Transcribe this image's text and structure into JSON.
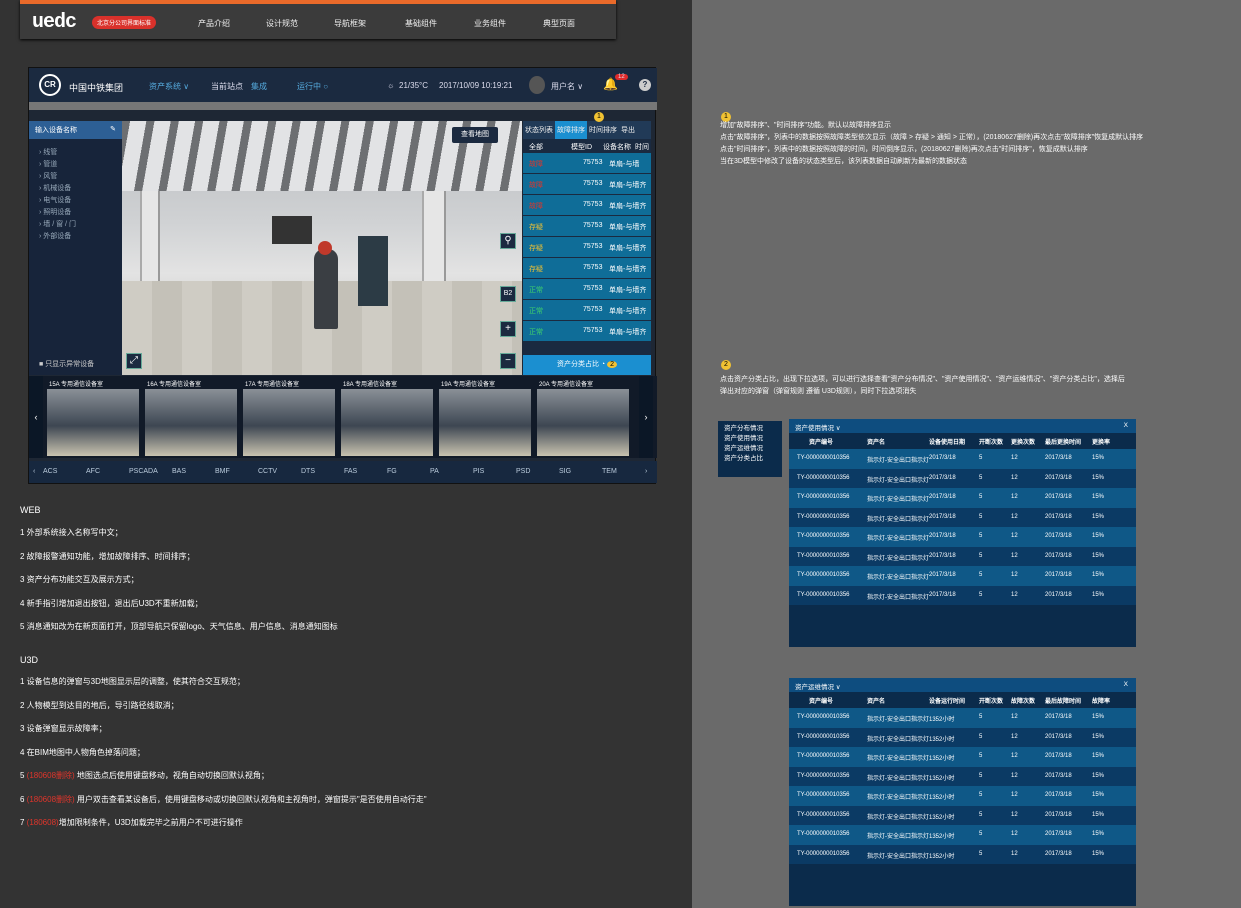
{
  "topnav": {
    "logo": "uedc",
    "badge": "北京分公司界面标准",
    "items": [
      "产品介绍",
      "设计规范",
      "导航框架",
      "基础组件",
      "业务组件",
      "典型页面"
    ]
  },
  "header": {
    "brand": "中国中铁集团",
    "system": "资产系统 ∨",
    "station_label": "当前站点",
    "station_value": "集成",
    "running": "运行中 ○",
    "weather": "21/35°C",
    "datetime": "2017/10/09  10:19:21",
    "user": "用户名 ∨",
    "notif": "12",
    "help": "?"
  },
  "sidebar": {
    "title": "输入设备名称",
    "items": [
      "线管",
      "管道",
      "风管",
      "机械设备",
      "电气设备",
      "照明设备",
      "墙 / 窗 / 门",
      "外部设备"
    ],
    "footer": "只显示异常设备"
  },
  "scene": {
    "map_button": "查看地图",
    "floor": "B2"
  },
  "status_panel": {
    "tabs": [
      "状态列表",
      "故障排序",
      "时间排序",
      "导出"
    ],
    "cols": [
      "全部",
      "模型ID",
      "设备名称",
      "时间"
    ],
    "rows": [
      {
        "state": "故障",
        "id": "75753",
        "name": "单扇-与墙"
      },
      {
        "state": "故障",
        "id": "75753",
        "name": "单扇-与墙齐"
      },
      {
        "state": "故障",
        "id": "75753",
        "name": "单扇-与墙齐"
      },
      {
        "state": "存疑",
        "id": "75753",
        "name": "单扇-与墙齐"
      },
      {
        "state": "存疑",
        "id": "75753",
        "name": "单扇-与墙齐"
      },
      {
        "state": "存疑",
        "id": "75753",
        "name": "单扇-与墙齐"
      },
      {
        "state": "正常",
        "id": "75753",
        "name": "单扇-与墙齐"
      },
      {
        "state": "正常",
        "id": "75753",
        "name": "单扇-与墙齐"
      },
      {
        "state": "正常",
        "id": "75753",
        "name": "单扇-与墙齐"
      }
    ],
    "footer": "资产分类占比",
    "marker1": "1",
    "marker2": "2"
  },
  "thumbs": [
    "15A 专用通信设备室",
    "16A 专用通信设备室",
    "17A 专用通信设备室",
    "18A 专用通信设备室",
    "19A 专用通信设备室",
    "20A 专用通信设备室"
  ],
  "sysbar": [
    "ACS",
    "AFC",
    "PSCADA",
    "BAS",
    "BMF",
    "CCTV",
    "DTS",
    "FAS",
    "FG",
    "PA",
    "PIS",
    "PSD",
    "SIG",
    "TEM"
  ],
  "web_title": "WEB",
  "web_notes": [
    "1 外部系统接入名称写中文；",
    "2 故障报警通知功能，增加故障排序、时间排序；",
    "3 资产分布功能交互及展示方式；",
    "4 新手指引增加退出按钮，退出后U3D不重新加载；",
    "5 消息通知改为在新页面打开，顶部导航只保留logo、天气信息、用户信息、消息通知图标"
  ],
  "u3d_title": "U3D",
  "u3d_notes": [
    {
      "pre": "1 设备信息的弹窗与3D地图显示层的调整，使其符合交互规范；",
      "red": "",
      "post": ""
    },
    {
      "pre": "2 人物模型到达目的地后，导引路径线取消；",
      "red": "",
      "post": ""
    },
    {
      "pre": "3 设备弹窗显示故障率；",
      "red": "",
      "post": ""
    },
    {
      "pre": "4 在BIM地图中人物角色掉落问题；",
      "red": "",
      "post": ""
    },
    {
      "pre": "5 ",
      "red": "(180608删除)",
      "post": " 地图选点后使用键盘移动，视角自动切换回默认视角；"
    },
    {
      "pre": "6 ",
      "red": "(180608删除)",
      "post": " 用户双击查看某设备后，使用键盘移动或切换回默认视角和主视角时，弹窗提示\"是否使用自动行走\""
    },
    {
      "pre": "7 ",
      "red": "(180608)",
      "post": "增加限制条件，U3D加载完毕之前用户不可进行操作"
    }
  ],
  "right_notes1": {
    "marker": "1",
    "lines": [
      "增加\"故障排序\"、\"时间排序\"功能。默认以故障排序显示",
      "点击\"故障排序\"，列表中的数据按照故障类型依次显示（故障 > 存疑 > 通知 > 正常），(20180627删除)再次点击\"故障排序\"恢复成默认排序",
      "点击\"时间排序\"，列表中的数据按照故障的时间，时间倒序显示，(20180627删除)再次点击\"时间排序\"，恢复成默认排序",
      "当在3D模型中修改了设备的状态类型后，该列表数据自动刷新为最新的数据状态"
    ]
  },
  "right_notes2": {
    "marker": "2",
    "lines": [
      "点击资产分类占比，出现下拉选项，可以进行选择查看\"资产分布情况\"、\"资产使用情况\"、\"资产运维情况\"、\"资产分类占比\"，选择后",
      "弹出对应的弹窗（弹窗规则 遵循 U3D规则），同时下拉选项消失"
    ]
  },
  "menu": [
    "资产分布情况",
    "资产使用情况",
    "资产运维情况",
    "资产分类占比"
  ],
  "table1": {
    "title": "资产使用情况 ∨",
    "close": "X",
    "cols": [
      "资产编号",
      "资产名",
      "设备使用日期",
      "开断次数",
      "更换次数",
      "最后更换时间",
      "更换率"
    ],
    "rows": [
      [
        "TY-0000000010356",
        "指示灯-安全出口指示灯",
        "2017/3/18",
        "5",
        "12",
        "2017/3/18",
        "15%"
      ],
      [
        "TY-0000000010356",
        "指示灯-安全出口指示灯",
        "2017/3/18",
        "5",
        "12",
        "2017/3/18",
        "15%"
      ],
      [
        "TY-0000000010356",
        "指示灯-安全出口指示灯",
        "2017/3/18",
        "5",
        "12",
        "2017/3/18",
        "15%"
      ],
      [
        "TY-0000000010356",
        "指示灯-安全出口指示灯",
        "2017/3/18",
        "5",
        "12",
        "2017/3/18",
        "15%"
      ],
      [
        "TY-0000000010356",
        "指示灯-安全出口指示灯",
        "2017/3/18",
        "5",
        "12",
        "2017/3/18",
        "15%"
      ],
      [
        "TY-0000000010356",
        "指示灯-安全出口指示灯",
        "2017/3/18",
        "5",
        "12",
        "2017/3/18",
        "15%"
      ],
      [
        "TY-0000000010356",
        "指示灯-安全出口指示灯",
        "2017/3/18",
        "5",
        "12",
        "2017/3/18",
        "15%"
      ],
      [
        "TY-0000000010356",
        "指示灯-安全出口指示灯",
        "2017/3/18",
        "5",
        "12",
        "2017/3/18",
        "15%"
      ]
    ]
  },
  "table2": {
    "title": "资产运维情况 ∨",
    "close": "X",
    "cols": [
      "资产编号",
      "资产名",
      "设备运行时间",
      "开断次数",
      "故障次数",
      "最后故障时间",
      "故障率"
    ],
    "rows": [
      [
        "TY-0000000010356",
        "指示灯-安全出口指示灯",
        "1352小时",
        "5",
        "12",
        "2017/3/18",
        "15%"
      ],
      [
        "TY-0000000010356",
        "指示灯-安全出口指示灯",
        "1352小时",
        "5",
        "12",
        "2017/3/18",
        "15%"
      ],
      [
        "TY-0000000010356",
        "指示灯-安全出口指示灯",
        "1352小时",
        "5",
        "12",
        "2017/3/18",
        "15%"
      ],
      [
        "TY-0000000010356",
        "指示灯-安全出口指示灯",
        "1352小时",
        "5",
        "12",
        "2017/3/18",
        "15%"
      ],
      [
        "TY-0000000010356",
        "指示灯-安全出口指示灯",
        "1352小时",
        "5",
        "12",
        "2017/3/18",
        "15%"
      ],
      [
        "TY-0000000010356",
        "指示灯-安全出口指示灯",
        "1352小时",
        "5",
        "12",
        "2017/3/18",
        "15%"
      ],
      [
        "TY-0000000010356",
        "指示灯-安全出口指示灯",
        "1352小时",
        "5",
        "12",
        "2017/3/18",
        "15%"
      ],
      [
        "TY-0000000010356",
        "指示灯-安全出口指示灯",
        "1352小时",
        "5",
        "12",
        "2017/3/18",
        "15%"
      ]
    ]
  }
}
